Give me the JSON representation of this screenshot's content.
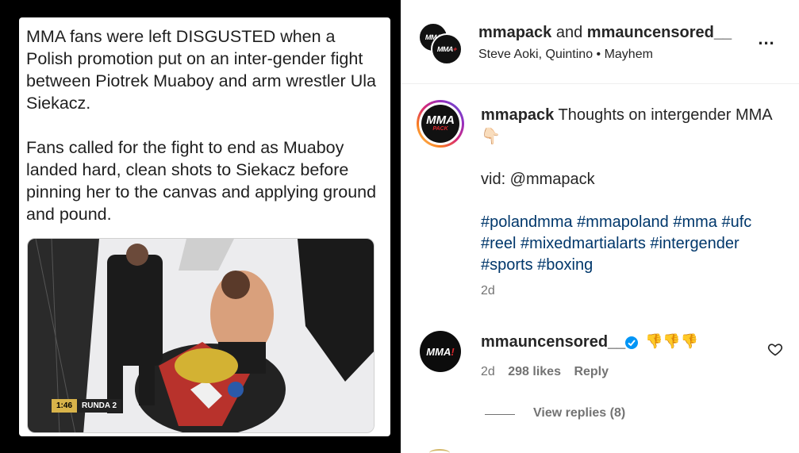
{
  "media": {
    "paragraph1": "MMA fans were left DISGUSTED when a Polish promotion put on an inter-gender fight between Piotrek Muaboy and arm wrestler Ula Siekacz.",
    "paragraph2": "Fans called for the fight to end as Muaboy landed hard, clean shots to Siekacz before pinning her to the canvas and applying ground and pound.",
    "score_time": "1:46",
    "score_round": "RUNDA 2"
  },
  "header": {
    "user1": "mmapack",
    "and_word": "and",
    "user2": "mmauncensored__",
    "audio": "Steve Aoki, Quintino • Mayhem",
    "more_label": "..."
  },
  "caption": {
    "username": "mmapack",
    "text": "Thoughts on intergender MMA",
    "emoji": "👇🏻",
    "credit": "vid: @mmapack",
    "hashtags": "#polandmma #mmapoland #mma #ufc #reel #mixedmartialarts #intergender #sports #boxing",
    "time": "2d"
  },
  "comment": {
    "username": "mmauncensored__",
    "text": "👎👎👎",
    "time": "2d",
    "likes": "298 likes",
    "reply_label": "Reply",
    "view_replies": "View replies (8)"
  },
  "colors": {
    "link": "#00376b",
    "muted": "#737373",
    "verified": "#0095f6",
    "brand_red": "#e0282e"
  },
  "icons": [
    "more-icon",
    "verified-icon",
    "heart-icon"
  ]
}
